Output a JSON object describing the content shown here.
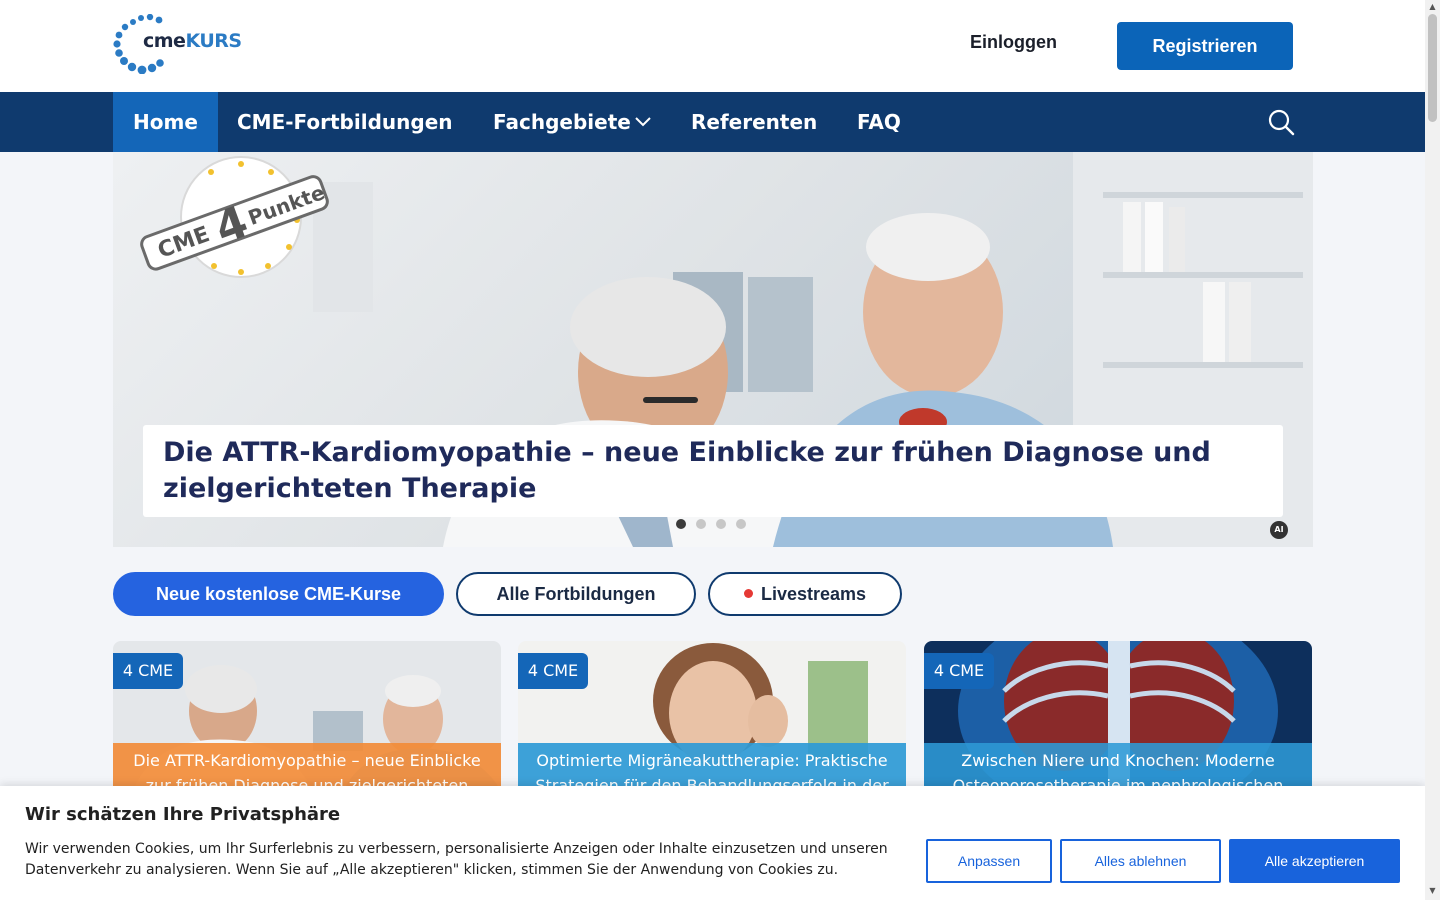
{
  "header": {
    "logo": {
      "part1": "cme",
      "part2": "KURS"
    },
    "login_label": "Einloggen",
    "register_label": "Registrieren"
  },
  "nav": {
    "items": [
      {
        "label": "Home",
        "active": true
      },
      {
        "label": "CME-Fortbildungen"
      },
      {
        "label": "Fachgebiete",
        "has_dropdown": true
      },
      {
        "label": "Referenten"
      },
      {
        "label": "FAQ"
      }
    ],
    "search_icon": "search-icon"
  },
  "hero": {
    "seal_text": "CME 4 Punkte",
    "title": "Die ATTR-Kardiomyopathie – neue Einblicke zur frühen Diagnose und zielgerichteten Therapie",
    "slide_count": 4,
    "active_slide": 1,
    "ai_badge": "AI"
  },
  "filters": [
    {
      "label": "Neue kostenlose CME-Kurse",
      "active": true
    },
    {
      "label": "Alle Fortbildungen"
    },
    {
      "label": "Livestreams",
      "live": true
    }
  ],
  "cards": [
    {
      "badge": "4 CME",
      "title": "Die ATTR-Kardiomyopathie – neue Einblicke zur frühen Diagnose und zielgerichteten Therapie",
      "color": "#f28c38"
    },
    {
      "badge": "4 CME",
      "title": "Optimierte Migräneakuttherapie: Praktische Strategien für den Behandlungserfolg in der",
      "color": "#2e9ad6"
    },
    {
      "badge": "4 CME",
      "title": "Zwischen Niere und Knochen: Moderne Osteoporosetherapie im nephrologischen",
      "color": "#2e9ad6"
    }
  ],
  "cookie": {
    "title": "Wir schätzen Ihre Privatsphäre",
    "text": "Wir verwenden Cookies, um Ihr Surferlebnis zu verbessern, personalisierte Anzeigen oder Inhalte einzusetzen und unseren Datenverkehr zu analysieren. Wenn Sie auf „Alle akzeptieren\" klicken, stimmen Sie der Anwendung von Cookies zu.",
    "customize_label": "Anpassen",
    "reject_label": "Alles ablehnen",
    "accept_label": "Alle akzeptieren"
  },
  "colors": {
    "nav_bg": "#0f3a6e",
    "nav_active": "#1466b8",
    "primary_button": "#0b64b8",
    "pill_active": "#2563e0",
    "cookie_accent": "#1863dc"
  }
}
